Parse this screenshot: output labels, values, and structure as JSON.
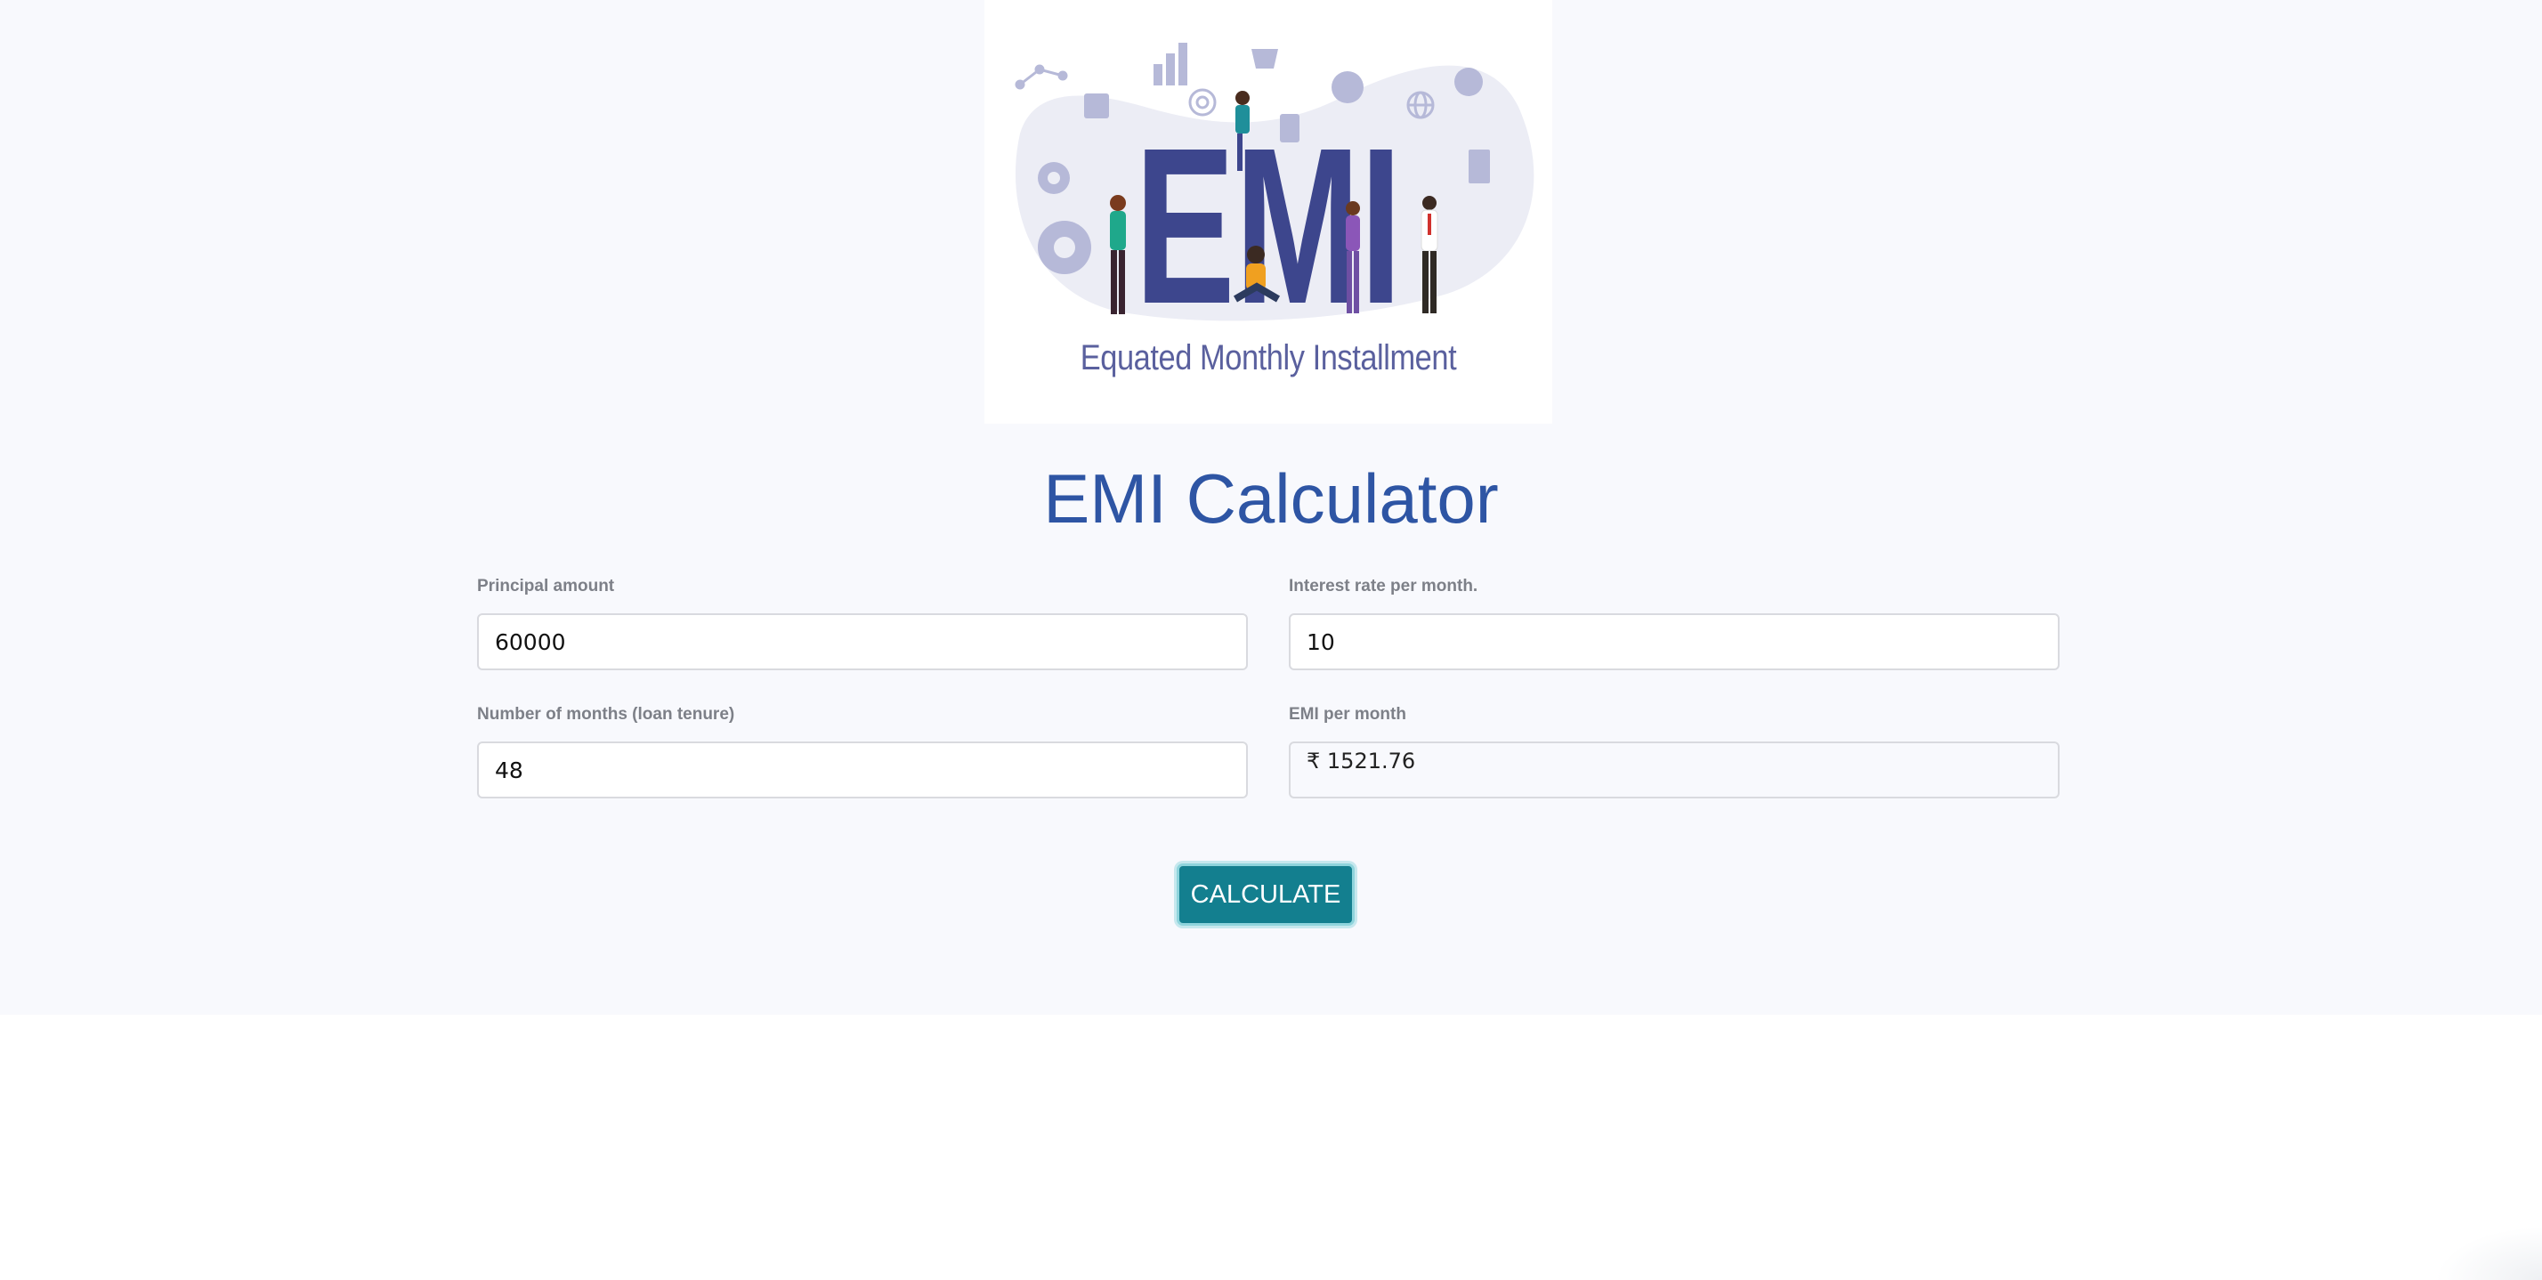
{
  "hero": {
    "logo_text": "EMI",
    "caption": "Equated Monthly Installment",
    "colors": {
      "letters": "#3d468d",
      "blob": "#ecedf5",
      "icons": "#b6b9d8"
    }
  },
  "title": "EMI Calculator",
  "form": {
    "principal": {
      "label": "Principal amount",
      "value": "60000"
    },
    "interest": {
      "label": "Interest rate per month.",
      "value": "10"
    },
    "months": {
      "label": "Number of months (loan tenure)",
      "value": "48"
    },
    "emi": {
      "label": "EMI per month",
      "value": "₹ 1521.76"
    }
  },
  "button": {
    "label": "CALCULATE"
  },
  "colors": {
    "page_background": "#f8f9fd",
    "title": "#2e55a4",
    "button": "#137f8f",
    "label": "#7d8088"
  }
}
